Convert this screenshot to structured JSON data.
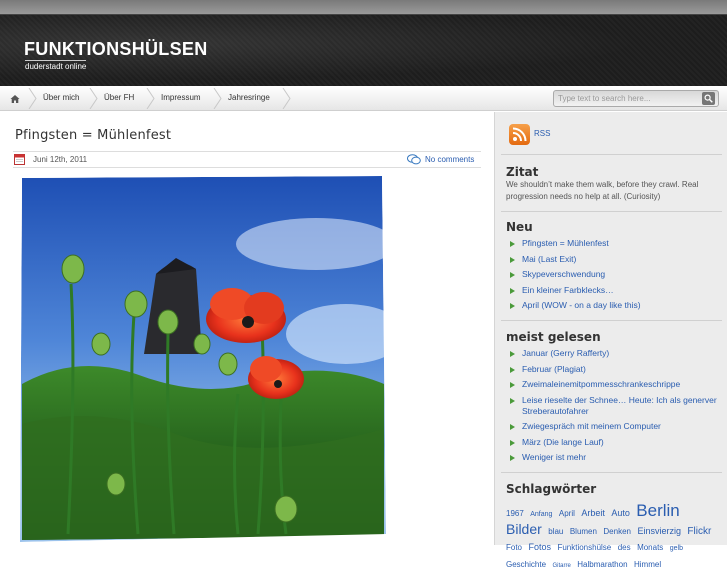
{
  "site": {
    "title": "FUNKTIONSHÜLSEN",
    "tagline": "duderstadt online"
  },
  "nav": {
    "home_icon": "home-icon",
    "items": [
      "Über mich",
      "Über FH",
      "Impressum",
      "Jahresringe"
    ],
    "search_placeholder": "Type text to search here..."
  },
  "post": {
    "title": "Pfingsten = Mühlenfest",
    "date": "Juni 12th, 2011",
    "comments": "No comments",
    "image_icon": "poppy-photo"
  },
  "sidebar": {
    "rss_label": "RSS",
    "quote_heading": "Zitat",
    "quote_text": "We shouldn’t make them walk, before they crawl. Real progression needs no help at all. (Curiosity)",
    "neu_heading": "Neu",
    "neu_items": [
      "Pfingsten = Mühlenfest",
      "Mai (Last Exit)",
      "Skypeverschwendung",
      "Ein kleiner Farbklecks…",
      "April (WOW - on a day like this)"
    ],
    "meist_heading": "meist gelesen",
    "meist_items": [
      "Januar (Gerry Rafferty)",
      "Februar (Plagiat)",
      "Zweimaleinemitpommesschrankeschrippe",
      "Leise rieselte der Schnee… Heute: Ich als generver Streberautofahrer",
      "Zwiegespräch mit meinem Computer",
      "März (Die lange Lauf)",
      "Weniger ist mehr"
    ],
    "tags_heading": "Schlagwörter",
    "tags": [
      {
        "t": "1967",
        "s": 8
      },
      {
        "t": "Anfang",
        "s": 7
      },
      {
        "t": "April",
        "s": 8
      },
      {
        "t": "Arbeit",
        "s": 9
      },
      {
        "t": "Auto",
        "s": 9
      },
      {
        "t": "Berlin",
        "s": 17
      },
      {
        "t": "Bilder",
        "s": 14
      },
      {
        "t": "blau",
        "s": 8
      },
      {
        "t": "Blumen",
        "s": 8
      },
      {
        "t": "Denken",
        "s": 8
      },
      {
        "t": "Einsvierzig",
        "s": 9
      },
      {
        "t": "Flickr",
        "s": 10
      },
      {
        "t": "Foto",
        "s": 8
      },
      {
        "t": "Fotos",
        "s": 9
      },
      {
        "t": "Funktionshülse",
        "s": 8
      },
      {
        "t": "des",
        "s": 8
      },
      {
        "t": "Monats",
        "s": 8
      },
      {
        "t": "gelb",
        "s": 7
      },
      {
        "t": "Geschichte",
        "s": 8
      },
      {
        "t": "Gitarre",
        "s": 6
      },
      {
        "t": "Halbmarathon",
        "s": 8
      },
      {
        "t": "Himmel",
        "s": 8
      }
    ]
  }
}
